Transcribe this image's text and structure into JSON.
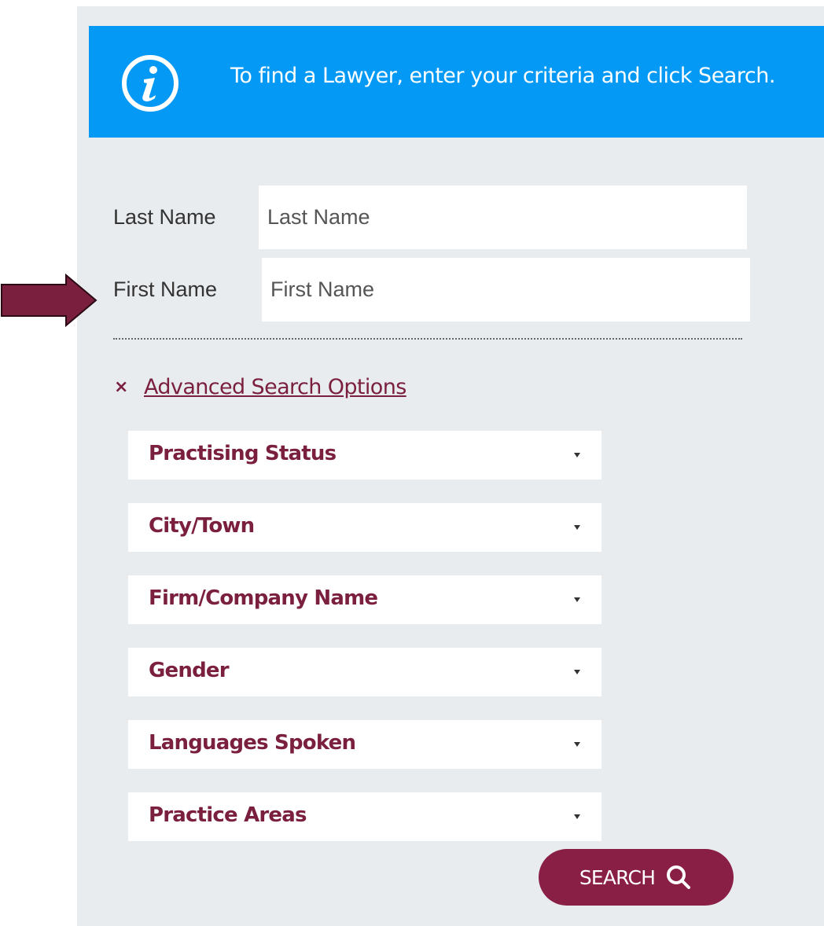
{
  "banner": {
    "text": "To find a Lawyer, enter your criteria and click Search.",
    "icon": "info-icon",
    "color": "#0399f5"
  },
  "fields": {
    "last_name": {
      "label": "Last Name",
      "placeholder": "Last Name",
      "value": ""
    },
    "first_name": {
      "label": "First Name",
      "placeholder": "First Name",
      "value": ""
    }
  },
  "advanced": {
    "toggle_icon": "×",
    "label": "Advanced Search Options"
  },
  "dropdowns": [
    {
      "label": "Practising Status"
    },
    {
      "label": "City/Town"
    },
    {
      "label": "Firm/Company Name"
    },
    {
      "label": "Gender"
    },
    {
      "label": "Languages Spoken"
    },
    {
      "label": "Practice Areas"
    }
  ],
  "search_button": {
    "label": "SEARCH",
    "icon": "search-icon",
    "color": "#8a1f45"
  },
  "annotation": {
    "icon": "arrow-right-icon",
    "color": "#7a1f3d"
  },
  "colors": {
    "accent": "#7a1f3d",
    "panel_bg": "#e8ecef"
  }
}
